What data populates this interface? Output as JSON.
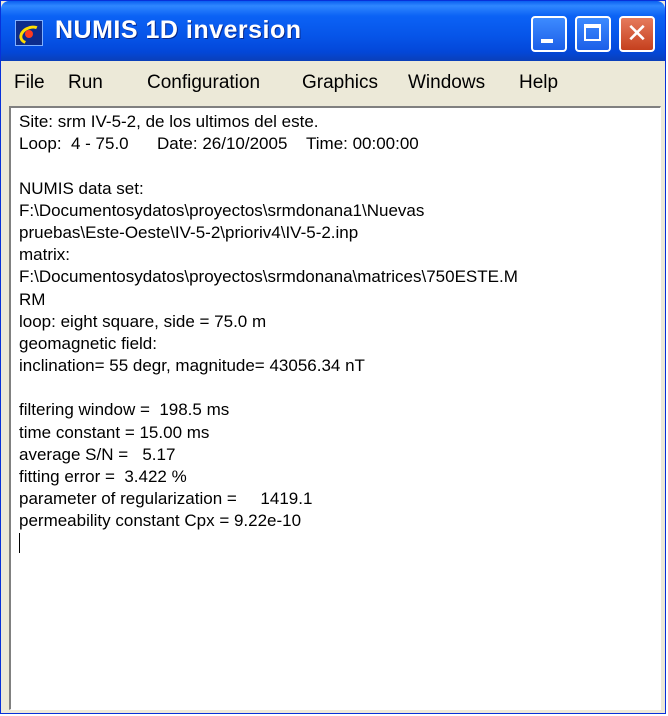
{
  "window": {
    "title": "NUMIS 1D inversion",
    "accent_color": "#0654e8",
    "close_color": "#d2552f"
  },
  "menu": {
    "items": [
      {
        "label": "File"
      },
      {
        "label": "Run"
      },
      {
        "label": "Configuration"
      },
      {
        "label": "Graphics"
      },
      {
        "label": "Windows"
      },
      {
        "label": "Help"
      }
    ]
  },
  "content": {
    "lines": [
      "Site: srm IV-5-2, de los ultimos del este.",
      "Loop:  4 - 75.0      Date: 26/10/2005    Time: 00:00:00",
      "",
      "NUMIS data set:",
      "F:\\Documentosydatos\\proyectos\\srmdonana1\\Nuevas",
      "pruebas\\Este-Oeste\\IV-5-2\\prioriv4\\IV-5-2.inp",
      "matrix:",
      "F:\\Documentosydatos\\proyectos\\srmdonana\\matrices\\750ESTE.M",
      "RM",
      "loop: eight square, side = 75.0 m",
      "geomagnetic field:",
      "inclination= 55 degr, magnitude= 43056.34 nT",
      "",
      "filtering window =  198.5 ms",
      "time constant = 15.00 ms",
      "average S/N =   5.17",
      "fitting error =  3.422 %",
      "parameter of regularization =     1419.1",
      "permeability constant Cpx = 9.22e-10"
    ]
  }
}
